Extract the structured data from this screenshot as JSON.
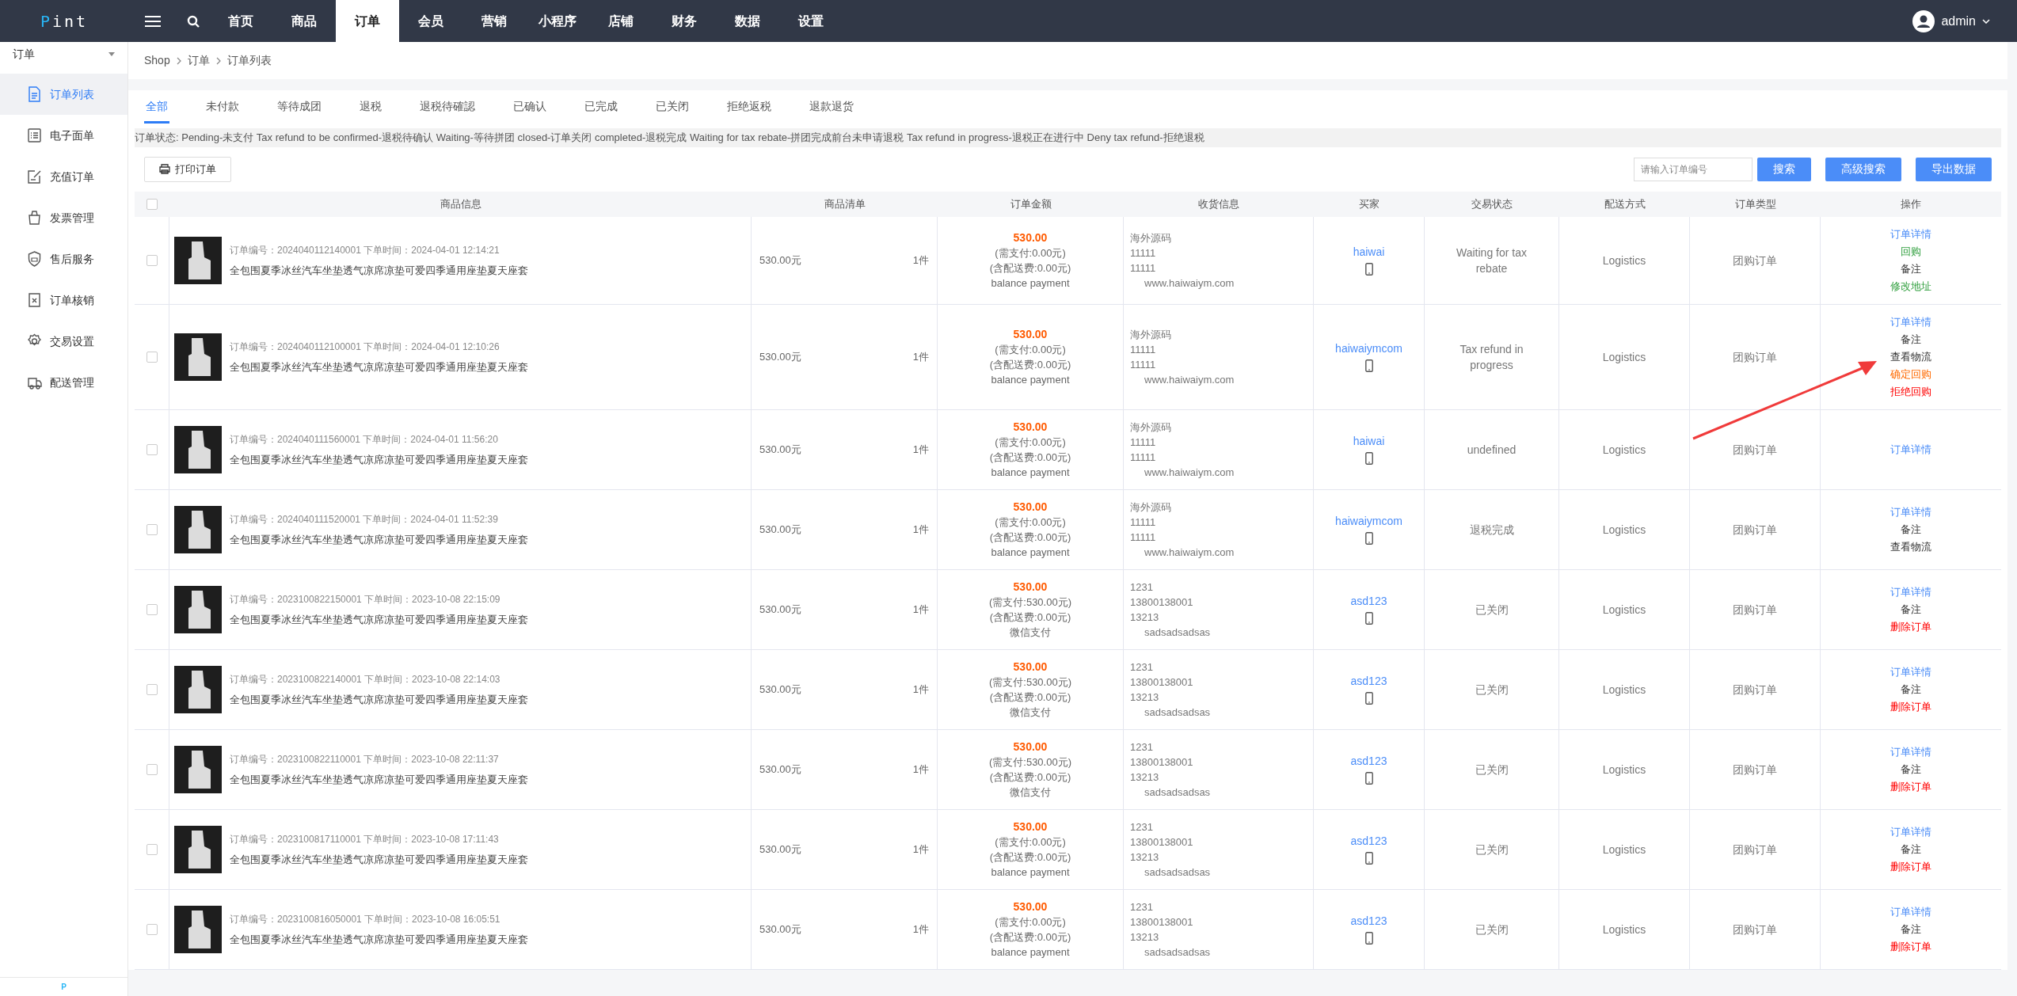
{
  "topbar": {
    "logo_mark": "P",
    "logo_text": "int",
    "nav": [
      {
        "label": "首页",
        "selected": false
      },
      {
        "label": "商品",
        "selected": false
      },
      {
        "label": "订单",
        "selected": true
      },
      {
        "label": "会员",
        "selected": false
      },
      {
        "label": "营销",
        "selected": false
      },
      {
        "label": "小程序",
        "selected": false
      },
      {
        "label": "店铺",
        "selected": false
      },
      {
        "label": "财务",
        "selected": false
      },
      {
        "label": "数据",
        "selected": false
      },
      {
        "label": "设置",
        "selected": false
      }
    ],
    "user": "admin"
  },
  "sidebar": {
    "title": "订单",
    "items": [
      {
        "label": "订单列表",
        "selected": true
      },
      {
        "label": "电子面单",
        "selected": false
      },
      {
        "label": "充值订单",
        "selected": false
      },
      {
        "label": "发票管理",
        "selected": false
      },
      {
        "label": "售后服务",
        "selected": false
      },
      {
        "label": "订单核销",
        "selected": false
      },
      {
        "label": "交易设置",
        "selected": false
      },
      {
        "label": "配送管理",
        "selected": false
      }
    ],
    "footer": "P"
  },
  "breadcrumb": [
    "Shop",
    "订单",
    "订单列表"
  ],
  "tabs": [
    {
      "label": "全部",
      "selected": true
    },
    {
      "label": "未付款",
      "selected": false
    },
    {
      "label": "等待成团",
      "selected": false
    },
    {
      "label": "退税",
      "selected": false
    },
    {
      "label": "退税待確認",
      "selected": false
    },
    {
      "label": "已确认",
      "selected": false
    },
    {
      "label": "已完成",
      "selected": false
    },
    {
      "label": "已关闭",
      "selected": false
    },
    {
      "label": "拒绝返税",
      "selected": false
    },
    {
      "label": "退款退货",
      "selected": false
    }
  ],
  "status_note": "订单状态: Pending-未支付 Tax refund to be confirmed-退税待确认 Waiting-等待拼团 closed-订单关闭 completed-退税完成 Waiting for tax rebate-拼团完成前台未申请退税 Tax refund in progress-退税正在进行中 Deny tax refund-拒绝退税",
  "toolbar": {
    "print_button": "打印订单",
    "search": {
      "placeholder": "请输入订单编号"
    },
    "buttons": [
      "搜索",
      "高级搜索",
      "导出数据"
    ]
  },
  "table": {
    "header_checked": false,
    "columns": [
      "商品信息",
      "商品清单",
      "订单金额",
      "收货信息",
      "买家",
      "交易状态",
      "配送方式",
      "订单类型",
      "操作"
    ],
    "rows": [
      {
        "checked": false,
        "meta": "订单编号：2024040112140001 下单时间：2024-04-01 12:14:21",
        "product": "全包围夏季冰丝汽车坐垫透气凉席凉垫可爱四季通用座垫夏天座套",
        "price": "530.00元",
        "qty": "1件",
        "amount": "530.00",
        "amount_lines": [
          "(需支付:0.00元)",
          "(含配送费:0.00元)",
          "balance payment"
        ],
        "address": [
          "海外源码",
          "11111",
          "11111"
        ],
        "address_detail": "www.haiwaiym.com",
        "buyer": "haiwai",
        "status": "Waiting for tax rebate",
        "delivery": "Logistics",
        "type": "团购订单",
        "actions": [
          {
            "label": "订单详情",
            "kind": "link"
          },
          {
            "label": "回购",
            "kind": "green"
          },
          {
            "label": "备注",
            "kind": "plain"
          },
          {
            "label": "修改地址",
            "kind": "green"
          }
        ]
      },
      {
        "checked": false,
        "meta": "订单编号：2024040112100001 下单时间：2024-04-01 12:10:26",
        "product": "全包围夏季冰丝汽车坐垫透气凉席凉垫可爱四季通用座垫夏天座套",
        "price": "530.00元",
        "qty": "1件",
        "amount": "530.00",
        "amount_lines": [
          "(需支付:0.00元)",
          "(含配送费:0.00元)",
          "balance payment"
        ],
        "address": [
          "海外源码",
          "11111",
          "11111"
        ],
        "address_detail": "www.haiwaiym.com",
        "buyer": "haiwaiymcom",
        "status": "Tax refund in progress",
        "delivery": "Logistics",
        "type": "团购订单",
        "actions": [
          {
            "label": "订单详情",
            "kind": "link"
          },
          {
            "label": "备注",
            "kind": "plain"
          },
          {
            "label": "查看物流",
            "kind": "plain"
          },
          {
            "label": "确定回购",
            "kind": "orange"
          },
          {
            "label": "拒绝回购",
            "kind": "red"
          }
        ]
      },
      {
        "checked": false,
        "meta": "订单编号：2024040111560001 下单时间：2024-04-01 11:56:20",
        "product": "全包围夏季冰丝汽车坐垫透气凉席凉垫可爱四季通用座垫夏天座套",
        "price": "530.00元",
        "qty": "1件",
        "amount": "530.00",
        "amount_lines": [
          "(需支付:0.00元)",
          "(含配送费:0.00元)",
          "balance payment"
        ],
        "address": [
          "海外源码",
          "11111",
          "11111"
        ],
        "address_detail": "www.haiwaiym.com",
        "buyer": "haiwai",
        "status": "undefined",
        "delivery": "Logistics",
        "type": "团购订单",
        "actions": [
          {
            "label": "订单详情",
            "kind": "link"
          }
        ]
      },
      {
        "checked": false,
        "meta": "订单编号：2024040111520001 下单时间：2024-04-01 11:52:39",
        "product": "全包围夏季冰丝汽车坐垫透气凉席凉垫可爱四季通用座垫夏天座套",
        "price": "530.00元",
        "qty": "1件",
        "amount": "530.00",
        "amount_lines": [
          "(需支付:0.00元)",
          "(含配送费:0.00元)",
          "balance payment"
        ],
        "address": [
          "海外源码",
          "11111",
          "11111"
        ],
        "address_detail": "www.haiwaiym.com",
        "buyer": "haiwaiymcom",
        "status": "退税完成",
        "delivery": "Logistics",
        "type": "团购订单",
        "actions": [
          {
            "label": "订单详情",
            "kind": "link"
          },
          {
            "label": "备注",
            "kind": "plain"
          },
          {
            "label": "查看物流",
            "kind": "plain"
          }
        ]
      },
      {
        "checked": false,
        "meta": "订单编号：2023100822150001 下单时间：2023-10-08 22:15:09",
        "product": "全包围夏季冰丝汽车坐垫透气凉席凉垫可爱四季通用座垫夏天座套",
        "price": "530.00元",
        "qty": "1件",
        "amount": "530.00",
        "amount_lines": [
          "(需支付:530.00元)",
          "(含配送费:0.00元)",
          "微信支付"
        ],
        "address": [
          "1231",
          "13800138001",
          "13213"
        ],
        "address_detail": "sadsadsadsas",
        "buyer": "asd123",
        "status": "已关闭",
        "delivery": "Logistics",
        "type": "团购订单",
        "actions": [
          {
            "label": "订单详情",
            "kind": "link"
          },
          {
            "label": "备注",
            "kind": "plain"
          },
          {
            "label": "删除订单",
            "kind": "red"
          }
        ]
      },
      {
        "checked": false,
        "meta": "订单编号：2023100822140001 下单时间：2023-10-08 22:14:03",
        "product": "全包围夏季冰丝汽车坐垫透气凉席凉垫可爱四季通用座垫夏天座套",
        "price": "530.00元",
        "qty": "1件",
        "amount": "530.00",
        "amount_lines": [
          "(需支付:530.00元)",
          "(含配送费:0.00元)",
          "微信支付"
        ],
        "address": [
          "1231",
          "13800138001",
          "13213"
        ],
        "address_detail": "sadsadsadsas",
        "buyer": "asd123",
        "status": "已关闭",
        "delivery": "Logistics",
        "type": "团购订单",
        "actions": [
          {
            "label": "订单详情",
            "kind": "link"
          },
          {
            "label": "备注",
            "kind": "plain"
          },
          {
            "label": "删除订单",
            "kind": "red"
          }
        ]
      },
      {
        "checked": false,
        "meta": "订单编号：2023100822110001 下单时间：2023-10-08 22:11:37",
        "product": "全包围夏季冰丝汽车坐垫透气凉席凉垫可爱四季通用座垫夏天座套",
        "price": "530.00元",
        "qty": "1件",
        "amount": "530.00",
        "amount_lines": [
          "(需支付:530.00元)",
          "(含配送费:0.00元)",
          "微信支付"
        ],
        "address": [
          "1231",
          "13800138001",
          "13213"
        ],
        "address_detail": "sadsadsadsas",
        "buyer": "asd123",
        "status": "已关闭",
        "delivery": "Logistics",
        "type": "团购订单",
        "actions": [
          {
            "label": "订单详情",
            "kind": "link"
          },
          {
            "label": "备注",
            "kind": "plain"
          },
          {
            "label": "删除订单",
            "kind": "red"
          }
        ]
      },
      {
        "checked": false,
        "meta": "订单编号：2023100817110001 下单时间：2023-10-08 17:11:43",
        "product": "全包围夏季冰丝汽车坐垫透气凉席凉垫可爱四季通用座垫夏天座套",
        "price": "530.00元",
        "qty": "1件",
        "amount": "530.00",
        "amount_lines": [
          "(需支付:0.00元)",
          "(含配送费:0.00元)",
          "balance payment"
        ],
        "address": [
          "1231",
          "13800138001",
          "13213"
        ],
        "address_detail": "sadsadsadsas",
        "buyer": "asd123",
        "status": "已关闭",
        "delivery": "Logistics",
        "type": "团购订单",
        "actions": [
          {
            "label": "订单详情",
            "kind": "link"
          },
          {
            "label": "备注",
            "kind": "plain"
          },
          {
            "label": "删除订单",
            "kind": "red"
          }
        ]
      },
      {
        "checked": false,
        "meta": "订单编号：2023100816050001 下单时间：2023-10-08 16:05:51",
        "product": "全包围夏季冰丝汽车坐垫透气凉席凉垫可爱四季通用座垫夏天座套",
        "price": "530.00元",
        "qty": "1件",
        "amount": "530.00",
        "amount_lines": [
          "(需支付:0.00元)",
          "(含配送费:0.00元)",
          "balance payment"
        ],
        "address": [
          "1231",
          "13800138001",
          "13213"
        ],
        "address_detail": "sadsadsadsas",
        "buyer": "asd123",
        "status": "已关闭",
        "delivery": "Logistics",
        "type": "团购订单",
        "actions": [
          {
            "label": "订单详情",
            "kind": "link"
          },
          {
            "label": "备注",
            "kind": "plain"
          },
          {
            "label": "删除订单",
            "kind": "red"
          }
        ]
      }
    ]
  }
}
